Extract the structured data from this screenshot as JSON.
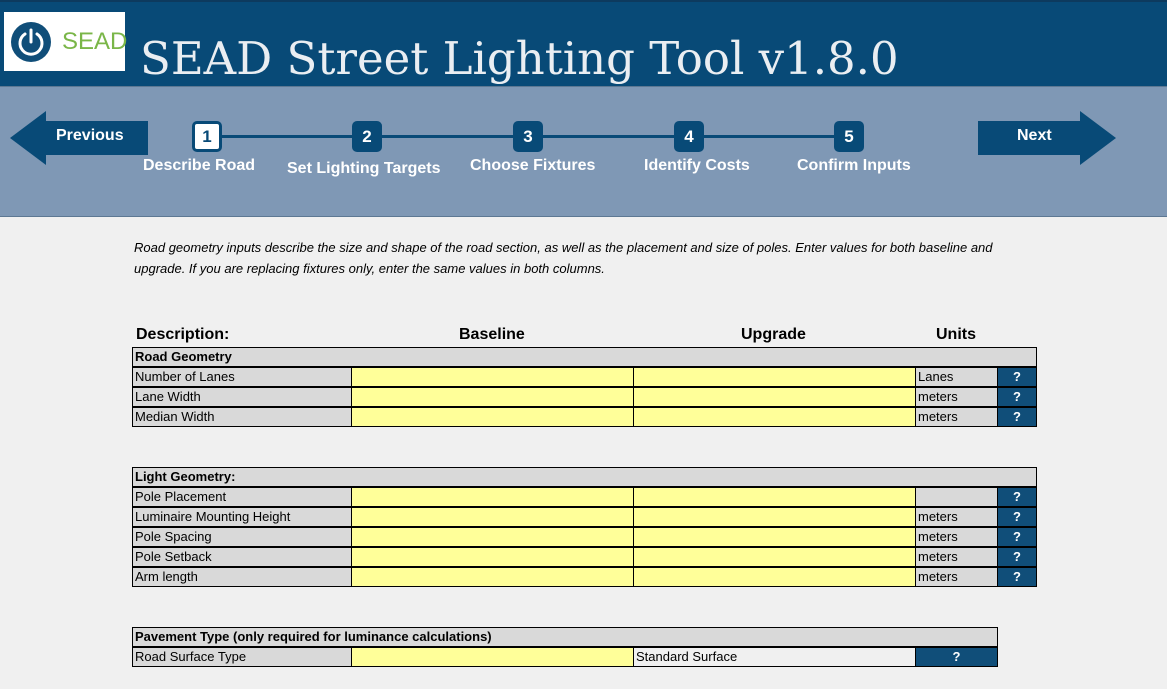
{
  "header": {
    "logo_text": "SEAD",
    "title": "SEAD Street Lighting Tool v1.8.0"
  },
  "nav": {
    "previous_label": "Previous",
    "next_label": "Next",
    "steps": [
      {
        "number": "1",
        "label": "Describe Road",
        "active": true
      },
      {
        "number": "2",
        "label": "Set Lighting Targets",
        "active": false
      },
      {
        "number": "3",
        "label": "Choose Fixtures",
        "active": false
      },
      {
        "number": "4",
        "label": "Identify Costs",
        "active": false
      },
      {
        "number": "5",
        "label": "Confirm Inputs",
        "active": false
      }
    ]
  },
  "intro_text": "Road geometry inputs describe the size and shape of the road section, as well as the placement and size of poles. Enter values for both baseline and upgrade. If you are replacing fixtures only, enter the same values in both columns.",
  "table": {
    "col_description": "Description:",
    "col_baseline": "Baseline",
    "col_upgrade": "Upgrade",
    "col_units": "Units",
    "help_label": "?",
    "road_geometry": {
      "title": "Road Geometry",
      "rows": [
        {
          "label": "Number of Lanes",
          "baseline": "",
          "upgrade": "",
          "unit": "Lanes"
        },
        {
          "label": "Lane Width",
          "baseline": "",
          "upgrade": "",
          "unit": "meters"
        },
        {
          "label": "Median Width",
          "baseline": "",
          "upgrade": "",
          "unit": "meters"
        }
      ]
    },
    "light_geometry": {
      "title": "Light Geometry:",
      "rows": [
        {
          "label": "Pole Placement",
          "baseline": "",
          "upgrade": "",
          "unit": ""
        },
        {
          "label": "Luminaire Mounting Height",
          "baseline": "",
          "upgrade": "",
          "unit": "meters"
        },
        {
          "label": "Pole Spacing",
          "baseline": "",
          "upgrade": "",
          "unit": "meters"
        },
        {
          "label": "Pole Setback",
          "baseline": "",
          "upgrade": "",
          "unit": "meters"
        },
        {
          "label": "Arm length",
          "baseline": "",
          "upgrade": "",
          "unit": "meters"
        }
      ]
    },
    "pavement": {
      "title": "Pavement Type (only required for luminance calculations)",
      "row": {
        "label": "Road Surface Type",
        "baseline": "",
        "value": "Standard Surface"
      }
    }
  },
  "colors": {
    "header_bg": "#084a77",
    "nav_band_bg": "#7f98b5",
    "input_yellow": "#ffff99",
    "label_gray": "#d9d9d9",
    "logo_green": "#7ab648"
  }
}
